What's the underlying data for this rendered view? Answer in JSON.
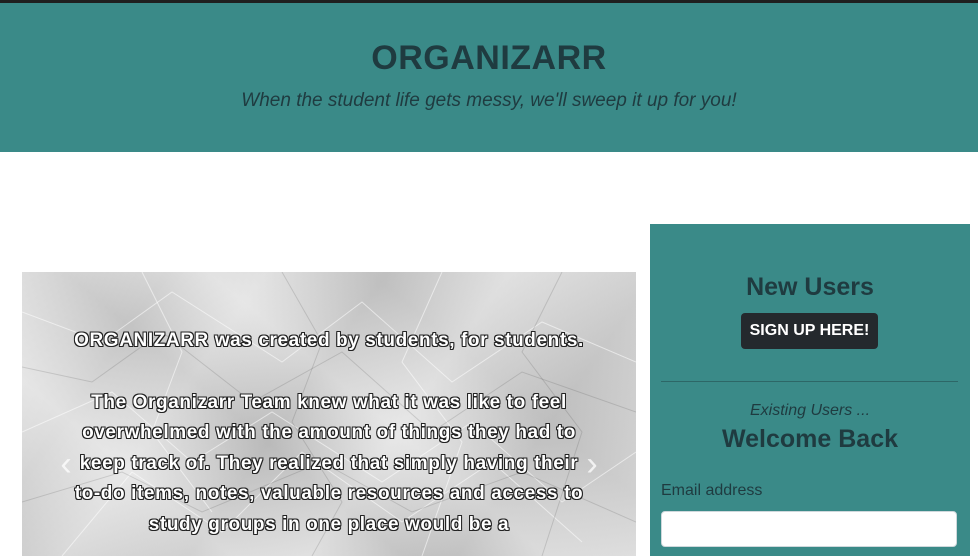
{
  "header": {
    "title": "ORGANIZARR",
    "tagline": "When the student life gets messy, we'll sweep it up for you!"
  },
  "carousel": {
    "slides": [
      {
        "paragraphs": [
          "ORGANIZARR was created by students, for students.",
          "The Organizarr Team knew what it was like to feel overwhelmed with the amount of things they had to keep track of. They realized that simply having their to-do items, notes, valuable resources and access to study groups in one place would be a"
        ]
      }
    ],
    "prev_icon": "chevron-left-icon",
    "next_icon": "chevron-right-icon",
    "prev_glyph": "‹",
    "next_glyph": "›"
  },
  "panel": {
    "new_users_heading": "New Users",
    "signup_label": "SIGN UP HERE!",
    "existing_text": "Existing Users ...",
    "welcome_heading": "Welcome Back",
    "email_label": "Email address",
    "email_value": ""
  },
  "colors": {
    "teal": "#3a8a88",
    "dark_text": "#1f3b40",
    "button": "#24292d"
  }
}
